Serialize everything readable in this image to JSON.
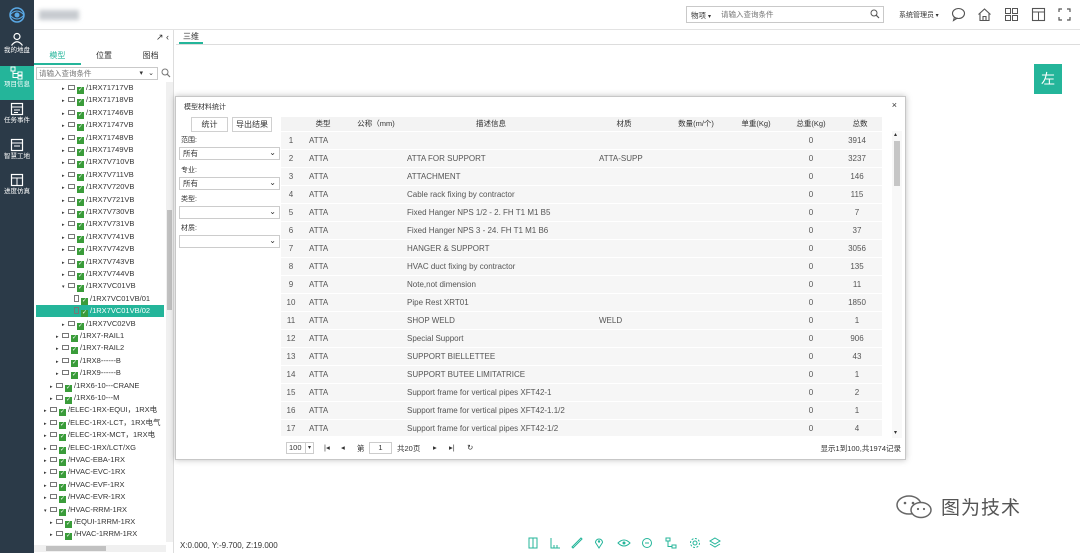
{
  "nav": {
    "items": [
      {
        "label": "我的地盘",
        "icon": "user-icon"
      },
      {
        "label": "项目信息",
        "icon": "hierarchy-icon"
      },
      {
        "label": "任务事件",
        "icon": "task-icon"
      },
      {
        "label": "智慧工地",
        "icon": "site-icon"
      },
      {
        "label": "进度仿真",
        "icon": "schedule-icon"
      }
    ],
    "active_index": 1
  },
  "header": {
    "search_type": "物项",
    "search_placeholder": "请输入查询条件",
    "user": "系统管理员"
  },
  "panel": {
    "tabs": [
      "模型",
      "位置",
      "图档"
    ],
    "active_tab": 0,
    "filter_placeholder": "请输入查询条件",
    "tree": [
      {
        "label": "/1RX71717VB",
        "indent": 2,
        "exp": "▸",
        "type": "folder"
      },
      {
        "label": "/1RX71718VB",
        "indent": 2,
        "exp": "▸",
        "type": "folder"
      },
      {
        "label": "/1RX71746VB",
        "indent": 2,
        "exp": "▸",
        "type": "folder"
      },
      {
        "label": "/1RX71747VB",
        "indent": 2,
        "exp": "▸",
        "type": "folder"
      },
      {
        "label": "/1RX71748VB",
        "indent": 2,
        "exp": "▸",
        "type": "folder"
      },
      {
        "label": "/1RX71749VB",
        "indent": 2,
        "exp": "▸",
        "type": "folder"
      },
      {
        "label": "/1RX7V710VB",
        "indent": 2,
        "exp": "▸",
        "type": "folder"
      },
      {
        "label": "/1RX7V711VB",
        "indent": 2,
        "exp": "▸",
        "type": "folder"
      },
      {
        "label": "/1RX7V720VB",
        "indent": 2,
        "exp": "▸",
        "type": "folder"
      },
      {
        "label": "/1RX7V721VB",
        "indent": 2,
        "exp": "▸",
        "type": "folder"
      },
      {
        "label": "/1RX7V730VB",
        "indent": 2,
        "exp": "▸",
        "type": "folder"
      },
      {
        "label": "/1RX7V731VB",
        "indent": 2,
        "exp": "▸",
        "type": "folder"
      },
      {
        "label": "/1RX7V741VB",
        "indent": 2,
        "exp": "▸",
        "type": "folder"
      },
      {
        "label": "/1RX7V742VB",
        "indent": 2,
        "exp": "▸",
        "type": "folder"
      },
      {
        "label": "/1RX7V743VB",
        "indent": 2,
        "exp": "▸",
        "type": "folder"
      },
      {
        "label": "/1RX7V744VB",
        "indent": 2,
        "exp": "▸",
        "type": "folder"
      },
      {
        "label": "/1RX7VC01VB",
        "indent": 2,
        "exp": "▾",
        "type": "folder"
      },
      {
        "label": "/1RX7VC01VB/01",
        "indent": 3,
        "exp": "",
        "type": "file"
      },
      {
        "label": "/1RX7VC01VB/02",
        "indent": 3,
        "exp": "",
        "type": "file"
      },
      {
        "label": "/1RX7VC02VB",
        "indent": 2,
        "exp": "▸",
        "type": "folder"
      },
      {
        "label": "/1RX7-RAIL1",
        "indent": 1,
        "exp": "▸",
        "type": "folder"
      },
      {
        "label": "/1RX7-RAIL2",
        "indent": 1,
        "exp": "▸",
        "type": "folder"
      },
      {
        "label": "/1RX8------B",
        "indent": 1,
        "exp": "▸",
        "type": "folder"
      },
      {
        "label": "/1RX9------B",
        "indent": 1,
        "exp": "▸",
        "type": "folder"
      },
      {
        "label": "/1RX6-10---CRANE",
        "indent": 0,
        "exp": "▸",
        "type": "folder"
      },
      {
        "label": "/1RX6-10---M",
        "indent": 0,
        "exp": "▸",
        "type": "folder"
      },
      {
        "label": "/ELEC-1RX-EQUI，1RX电",
        "indent": -1,
        "exp": "▸",
        "type": "folder"
      },
      {
        "label": "/ELEC-1RX-LCT，1RX电气",
        "indent": -1,
        "exp": "▸",
        "type": "folder"
      },
      {
        "label": "/ELEC-1RX-MCT，1RX电",
        "indent": -1,
        "exp": "▸",
        "type": "folder"
      },
      {
        "label": "/ELEC-1RX/LCT/XG",
        "indent": -1,
        "exp": "▸",
        "type": "folder"
      },
      {
        "label": "/HVAC-EBA-1RX",
        "indent": -1,
        "exp": "▸",
        "type": "folder"
      },
      {
        "label": "/HVAC-EVC-1RX",
        "indent": -1,
        "exp": "▸",
        "type": "folder"
      },
      {
        "label": "/HVAC-EVF-1RX",
        "indent": -1,
        "exp": "▸",
        "type": "folder"
      },
      {
        "label": "/HVAC-EVR-1RX",
        "indent": -1,
        "exp": "▸",
        "type": "folder"
      },
      {
        "label": "/HVAC-RRM-1RX",
        "indent": -1,
        "exp": "▾",
        "type": "folder"
      },
      {
        "label": "/EQUI-1RRM-1RX",
        "indent": 0,
        "exp": "▸",
        "type": "folder"
      },
      {
        "label": "/HVAC-1RRM-1RX",
        "indent": 0,
        "exp": "▸",
        "type": "folder"
      }
    ],
    "selected_index": 18
  },
  "viewport": {
    "tab": "三维",
    "side_label": "左",
    "coords": "X:0.000, Y:-9.700, Z:19.000"
  },
  "dialog": {
    "title": "模型材料统计",
    "btn_stats": "统计",
    "btn_export": "导出结果",
    "filters": [
      {
        "label": "范围:",
        "value": "所有"
      },
      {
        "label": "专业:",
        "value": "所有"
      },
      {
        "label": "类型:",
        "value": ""
      },
      {
        "label": "材质:",
        "value": ""
      }
    ],
    "columns": [
      "类型",
      "公称（mm)",
      "描述信息",
      "材质",
      "数量(m/个)",
      "单重(Kg)",
      "总重(Kg)",
      "总数"
    ],
    "rows": [
      {
        "n": "1",
        "type": "ATTA",
        "nom": "",
        "desc": "",
        "mat": "",
        "qty": "",
        "unit": "",
        "weight": "0",
        "total": "3914"
      },
      {
        "n": "2",
        "type": "ATTA",
        "nom": "",
        "desc": "ATTA FOR SUPPORT",
        "mat": "ATTA-SUPP",
        "qty": "",
        "unit": "",
        "weight": "0",
        "total": "3237"
      },
      {
        "n": "3",
        "type": "ATTA",
        "nom": "",
        "desc": "ATTACHMENT",
        "mat": "",
        "qty": "",
        "unit": "",
        "weight": "0",
        "total": "146"
      },
      {
        "n": "4",
        "type": "ATTA",
        "nom": "",
        "desc": "Cable rack fixing by contractor",
        "mat": "",
        "qty": "",
        "unit": "",
        "weight": "0",
        "total": "115"
      },
      {
        "n": "5",
        "type": "ATTA",
        "nom": "",
        "desc": "Fixed Hanger NPS 1/2 - 2. FH T1 M1 B5",
        "mat": "",
        "qty": "",
        "unit": "",
        "weight": "0",
        "total": "7"
      },
      {
        "n": "6",
        "type": "ATTA",
        "nom": "",
        "desc": "Fixed Hanger NPS 3 - 24. FH T1 M1 B6",
        "mat": "",
        "qty": "",
        "unit": "",
        "weight": "0",
        "total": "37"
      },
      {
        "n": "7",
        "type": "ATTA",
        "nom": "",
        "desc": "HANGER & SUPPORT",
        "mat": "",
        "qty": "",
        "unit": "",
        "weight": "0",
        "total": "3056"
      },
      {
        "n": "8",
        "type": "ATTA",
        "nom": "",
        "desc": "HVAC duct fixing by contractor",
        "mat": "",
        "qty": "",
        "unit": "",
        "weight": "0",
        "total": "135"
      },
      {
        "n": "9",
        "type": "ATTA",
        "nom": "",
        "desc": "Note,not dimension",
        "mat": "",
        "qty": "",
        "unit": "",
        "weight": "0",
        "total": "11"
      },
      {
        "n": "10",
        "type": "ATTA",
        "nom": "",
        "desc": "Pipe Rest XRT01",
        "mat": "",
        "qty": "",
        "unit": "",
        "weight": "0",
        "total": "1850"
      },
      {
        "n": "11",
        "type": "ATTA",
        "nom": "",
        "desc": "SHOP WELD",
        "mat": "WELD",
        "qty": "",
        "unit": "",
        "weight": "0",
        "total": "1"
      },
      {
        "n": "12",
        "type": "ATTA",
        "nom": "",
        "desc": "Special Support",
        "mat": "",
        "qty": "",
        "unit": "",
        "weight": "0",
        "total": "906"
      },
      {
        "n": "13",
        "type": "ATTA",
        "nom": "",
        "desc": "SUPPORT BIELLETTEE",
        "mat": "",
        "qty": "",
        "unit": "",
        "weight": "0",
        "total": "43"
      },
      {
        "n": "14",
        "type": "ATTA",
        "nom": "",
        "desc": "SUPPORT BUTEE LIMITATRICE",
        "mat": "",
        "qty": "",
        "unit": "",
        "weight": "0",
        "total": "1"
      },
      {
        "n": "15",
        "type": "ATTA",
        "nom": "",
        "desc": "Support frame for vertical pipes XFT42-1",
        "mat": "",
        "qty": "",
        "unit": "",
        "weight": "0",
        "total": "2"
      },
      {
        "n": "16",
        "type": "ATTA",
        "nom": "",
        "desc": "Support frame for vertical pipes XFT42-1.1/2",
        "mat": "",
        "qty": "",
        "unit": "",
        "weight": "0",
        "total": "1"
      },
      {
        "n": "17",
        "type": "ATTA",
        "nom": "",
        "desc": "Support frame for vertical pipes XFT42-1/2",
        "mat": "",
        "qty": "",
        "unit": "",
        "weight": "0",
        "total": "4"
      }
    ],
    "pager": {
      "page_size": "100",
      "page_prefix": "第",
      "page": "1",
      "page_total": "共20页",
      "info": "显示1到100,共1974记录"
    }
  },
  "watermark": {
    "text": "图为技术"
  },
  "colors": {
    "accent": "#24b59a",
    "sidebar": "#2b3a48"
  }
}
